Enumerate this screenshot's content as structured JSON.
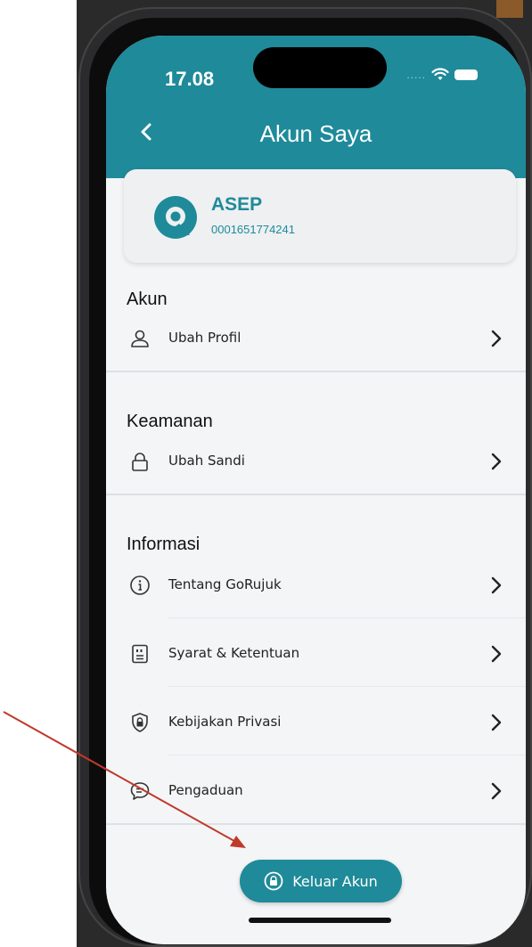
{
  "status_bar": {
    "time": "17.08",
    "signal": "....."
  },
  "header": {
    "title": "Akun Saya"
  },
  "profile": {
    "name": "ASEP",
    "id": "0001651774241"
  },
  "sections": {
    "akun": {
      "title": "Akun",
      "items": [
        {
          "label": "Ubah Profil",
          "icon": "person-icon"
        }
      ]
    },
    "keamanan": {
      "title": "Keamanan",
      "items": [
        {
          "label": "Ubah Sandi",
          "icon": "lock-icon"
        }
      ]
    },
    "informasi": {
      "title": "Informasi",
      "items": [
        {
          "label": "Tentang GoRujuk",
          "icon": "info-icon"
        },
        {
          "label": "Syarat & Ketentuan",
          "icon": "document-quote-icon"
        },
        {
          "label": "Kebijakan Privasi",
          "icon": "shield-lock-icon"
        },
        {
          "label": "Pengaduan",
          "icon": "chat-bubble-icon"
        }
      ]
    }
  },
  "logout": {
    "label": "Keluar Akun",
    "icon": "lock-circle-icon"
  },
  "colors": {
    "primary": "#1f8a99",
    "background": "#f3f5f7",
    "arrow": "#c0392b"
  }
}
